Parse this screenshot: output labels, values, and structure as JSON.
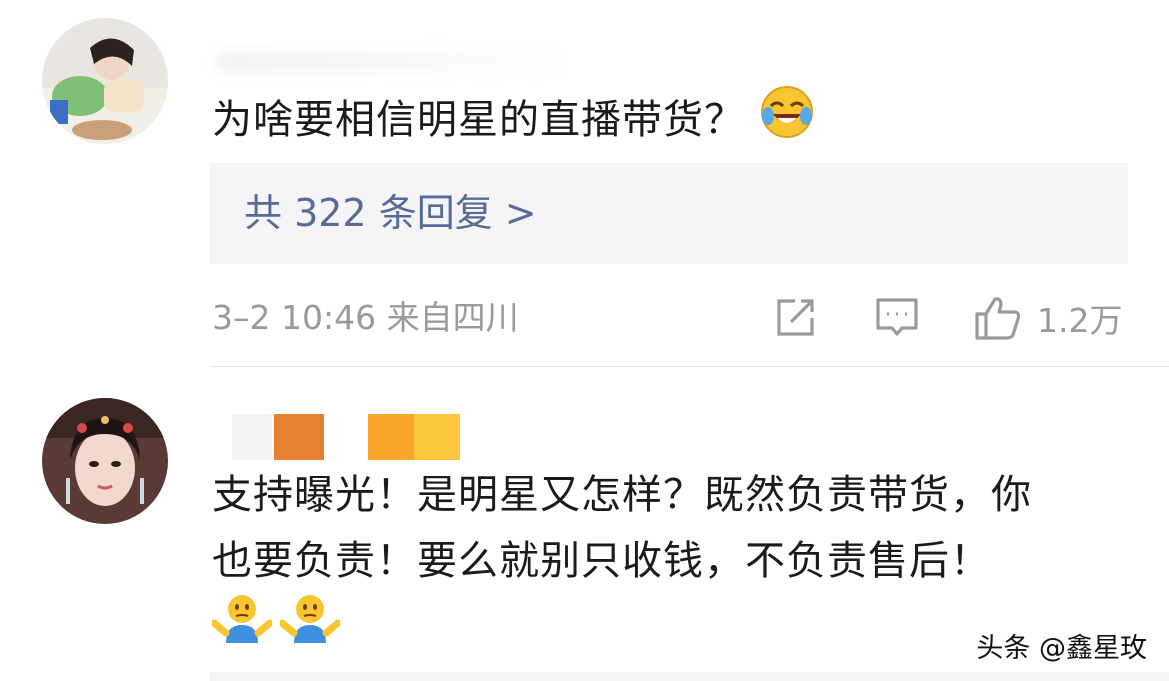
{
  "comments": [
    {
      "text": "为啥要相信明星的直播带货？",
      "emoji": [
        "face-with-tears-of-joy"
      ],
      "replies_label": "共 322 条回复 >",
      "meta": "3–2 10:46  来自四川",
      "likes": "1.2万",
      "actions": [
        "share-icon",
        "comment-icon",
        "like-icon"
      ]
    },
    {
      "text_line1": "支持曝光！是明星又怎样？既然负责带货，你",
      "text_line2": "也要负责！要么就别只收钱，不负责售后！",
      "emoji": [
        "person-shrugging",
        "person-shrugging"
      ]
    }
  ],
  "watermark": "头条 @鑫星玫",
  "colors": {
    "link": "#566c95",
    "meta": "#9a9a9a",
    "reply_bg": "#f5f5f7",
    "mosaic": [
      "#e8812f",
      "#f8a52c",
      "#fdc53a"
    ]
  }
}
